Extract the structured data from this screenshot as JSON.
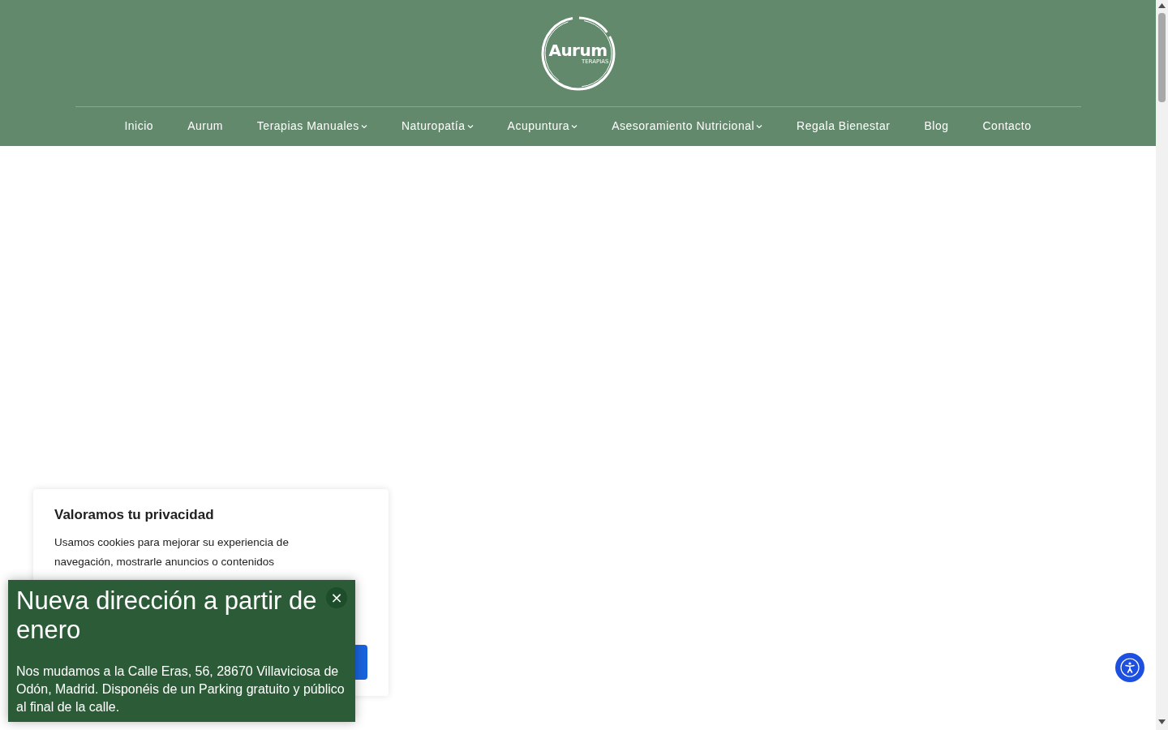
{
  "header": {
    "logo": {
      "name": "Aurum",
      "tagline": "TERAPIAS"
    },
    "nav": [
      {
        "label": "Inicio",
        "dropdown": false
      },
      {
        "label": "Aurum",
        "dropdown": false
      },
      {
        "label": "Terapias Manuales",
        "dropdown": true
      },
      {
        "label": "Naturopatía",
        "dropdown": true
      },
      {
        "label": "Acupuntura",
        "dropdown": true
      },
      {
        "label": "Asesoramiento Nutricional",
        "dropdown": true
      },
      {
        "label": "Regala Bienestar",
        "dropdown": false
      },
      {
        "label": "Blog",
        "dropdown": false
      },
      {
        "label": "Contacto",
        "dropdown": false
      }
    ]
  },
  "cookie_banner": {
    "title": "Valoramos tu privacidad",
    "text": "Usamos cookies para mejorar su experiencia de navegación, mostrarle anuncios o contenidos"
  },
  "notice_popup": {
    "title": "Nueva dirección a partir de enero",
    "text": "Nos mudamos a la Calle Eras, 56, 28670 Villaviciosa de Odón, Madrid. Disponéis de un Parking gratuito y público al final de la calle.",
    "close": "×"
  }
}
